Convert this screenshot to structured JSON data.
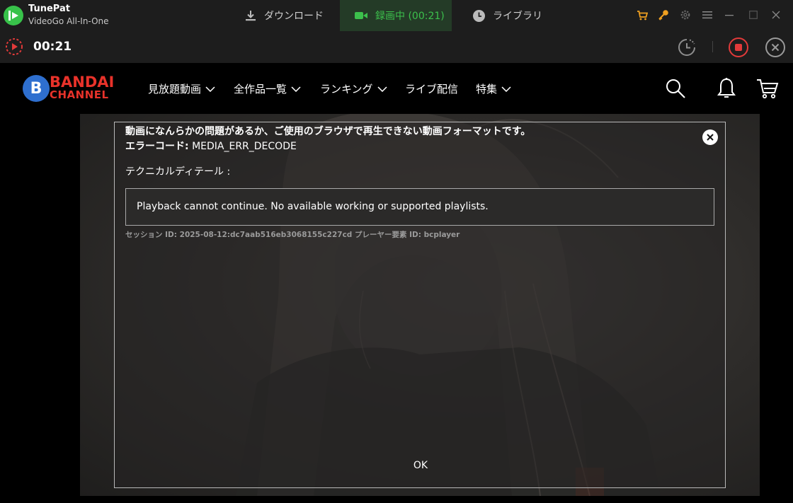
{
  "app": {
    "name": "TunePat",
    "subtitle": "VideoGo All-In-One"
  },
  "tabs": [
    {
      "label": "ダウンロード",
      "icon": "download-icon"
    },
    {
      "label": "録画中 (00:21)",
      "icon": "video-camera-icon",
      "active": true
    },
    {
      "label": "ライブラリ",
      "icon": "clock-icon"
    }
  ],
  "titlebar_icons": [
    "cart-icon",
    "key-icon",
    "gear-icon",
    "menu-icon",
    "minimize-icon",
    "maximize-icon",
    "close-icon"
  ],
  "recording": {
    "time": "00:21",
    "icons": [
      "record-indicator-icon",
      "schedule-timer-icon",
      "stop-record-icon",
      "close-circle-icon"
    ]
  },
  "site": {
    "brand_top": "BANDAI",
    "brand_bottom": "CHANNEL",
    "brand_badge": "B",
    "nav": [
      {
        "label": "見放題動画",
        "has_dropdown": true
      },
      {
        "label": "全作品一覧",
        "has_dropdown": true
      },
      {
        "label": "ランキング",
        "has_dropdown": true
      },
      {
        "label": "ライブ配信",
        "has_dropdown": false
      },
      {
        "label": "特集",
        "has_dropdown": true
      }
    ],
    "header_icons": [
      "search-icon",
      "bell-icon",
      "cart-icon"
    ]
  },
  "error": {
    "message": "動画になんらかの問題があるか、ご使用のブラウザで再生できない動画フォーマットです。",
    "code_label": "エラーコード:",
    "code_value": "MEDIA_ERR_DECODE",
    "tech_label": "テクニカルディテール :",
    "tech_detail": "Playback cannot continue. No available working or supported playlists.",
    "session": "セッション ID: 2025-08-12:dc7aab516eb3068155c227cd プレーヤー要素 ID: bcplayer",
    "ok_label": "OK"
  },
  "colors": {
    "accent_green": "#3cc04c",
    "titlebar_bg": "#1d1d1d",
    "brand_red": "#e8322a",
    "brand_blue": "#2e6fcf",
    "orange_icons": "#f0a020",
    "stop_red": "#e23a3a"
  }
}
